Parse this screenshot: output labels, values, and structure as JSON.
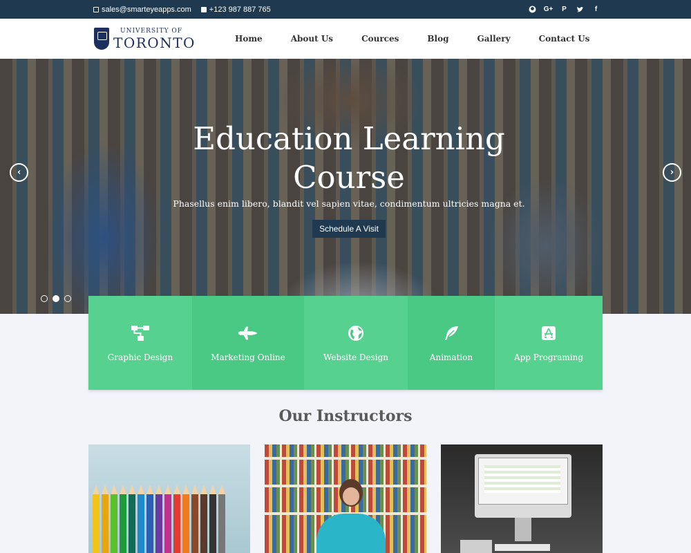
{
  "topbar": {
    "email": "sales@smarteyeapps.com",
    "phone": "+123 987 887 765",
    "social": [
      "github-icon",
      "google-plus-icon",
      "pinterest-icon",
      "twitter-icon",
      "facebook-icon"
    ],
    "social_glyphs": [
      "",
      "G+",
      "P",
      "",
      "f"
    ]
  },
  "logo": {
    "line1": "UNIVERSITY OF",
    "line2": "TORONTO"
  },
  "nav": [
    "Home",
    "About Us",
    "Cources",
    "Blog",
    "Gallery",
    "Contact Us"
  ],
  "hero": {
    "title_line1": "Education Learning",
    "title_line2": "Course",
    "subtitle": "Phasellus enim libero, blandit vel sapien vitae, condimentum ultricies magna et.",
    "cta": "Schedule A Visit",
    "slide_count": 3,
    "active_slide": 2
  },
  "services": [
    {
      "label": "Graphic Design",
      "icon": "sitemap-icon"
    },
    {
      "label": "Marketing Online",
      "icon": "space-shuttle-icon"
    },
    {
      "label": "Website Design",
      "icon": "globe-icon"
    },
    {
      "label": "Animation",
      "icon": "feather-icon"
    },
    {
      "label": "App Programing",
      "icon": "app-store-icon"
    }
  ],
  "instructors": {
    "title": "Our Instructors"
  },
  "colors": {
    "topbar": "#1f3a50",
    "green": "#57d18f",
    "green_dark": "#4ac985",
    "cta": "#1f3a50"
  }
}
